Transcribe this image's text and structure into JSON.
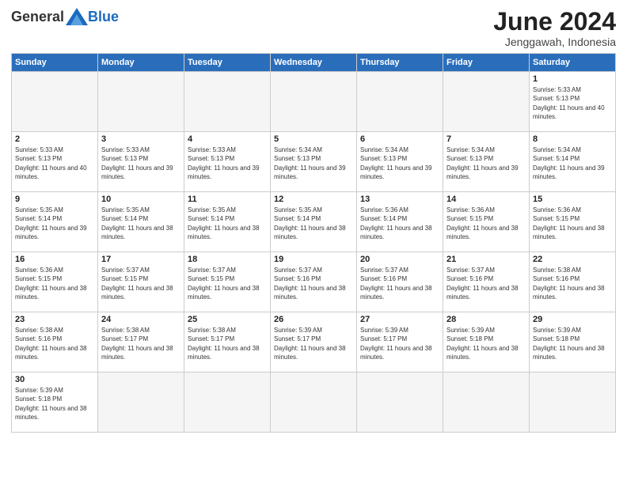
{
  "logo": {
    "general": "General",
    "blue": "Blue"
  },
  "title": {
    "month": "June 2024",
    "location": "Jenggawah, Indonesia"
  },
  "weekdays": [
    "Sunday",
    "Monday",
    "Tuesday",
    "Wednesday",
    "Thursday",
    "Friday",
    "Saturday"
  ],
  "weeks": [
    [
      {
        "day": "",
        "empty": true
      },
      {
        "day": "",
        "empty": true
      },
      {
        "day": "",
        "empty": true
      },
      {
        "day": "",
        "empty": true
      },
      {
        "day": "",
        "empty": true
      },
      {
        "day": "",
        "empty": true
      },
      {
        "day": "1",
        "sunrise": "Sunrise: 5:33 AM",
        "sunset": "Sunset: 5:13 PM",
        "daylight": "Daylight: 11 hours and 40 minutes."
      }
    ],
    [
      {
        "day": "2",
        "sunrise": "Sunrise: 5:33 AM",
        "sunset": "Sunset: 5:13 PM",
        "daylight": "Daylight: 11 hours and 40 minutes."
      },
      {
        "day": "3",
        "sunrise": "Sunrise: 5:33 AM",
        "sunset": "Sunset: 5:13 PM",
        "daylight": "Daylight: 11 hours and 39 minutes."
      },
      {
        "day": "4",
        "sunrise": "Sunrise: 5:33 AM",
        "sunset": "Sunset: 5:13 PM",
        "daylight": "Daylight: 11 hours and 39 minutes."
      },
      {
        "day": "5",
        "sunrise": "Sunrise: 5:34 AM",
        "sunset": "Sunset: 5:13 PM",
        "daylight": "Daylight: 11 hours and 39 minutes."
      },
      {
        "day": "6",
        "sunrise": "Sunrise: 5:34 AM",
        "sunset": "Sunset: 5:13 PM",
        "daylight": "Daylight: 11 hours and 39 minutes."
      },
      {
        "day": "7",
        "sunrise": "Sunrise: 5:34 AM",
        "sunset": "Sunset: 5:13 PM",
        "daylight": "Daylight: 11 hours and 39 minutes."
      },
      {
        "day": "8",
        "sunrise": "Sunrise: 5:34 AM",
        "sunset": "Sunset: 5:14 PM",
        "daylight": "Daylight: 11 hours and 39 minutes."
      }
    ],
    [
      {
        "day": "9",
        "sunrise": "Sunrise: 5:35 AM",
        "sunset": "Sunset: 5:14 PM",
        "daylight": "Daylight: 11 hours and 39 minutes."
      },
      {
        "day": "10",
        "sunrise": "Sunrise: 5:35 AM",
        "sunset": "Sunset: 5:14 PM",
        "daylight": "Daylight: 11 hours and 38 minutes."
      },
      {
        "day": "11",
        "sunrise": "Sunrise: 5:35 AM",
        "sunset": "Sunset: 5:14 PM",
        "daylight": "Daylight: 11 hours and 38 minutes."
      },
      {
        "day": "12",
        "sunrise": "Sunrise: 5:35 AM",
        "sunset": "Sunset: 5:14 PM",
        "daylight": "Daylight: 11 hours and 38 minutes."
      },
      {
        "day": "13",
        "sunrise": "Sunrise: 5:36 AM",
        "sunset": "Sunset: 5:14 PM",
        "daylight": "Daylight: 11 hours and 38 minutes."
      },
      {
        "day": "14",
        "sunrise": "Sunrise: 5:36 AM",
        "sunset": "Sunset: 5:15 PM",
        "daylight": "Daylight: 11 hours and 38 minutes."
      },
      {
        "day": "15",
        "sunrise": "Sunrise: 5:36 AM",
        "sunset": "Sunset: 5:15 PM",
        "daylight": "Daylight: 11 hours and 38 minutes."
      }
    ],
    [
      {
        "day": "16",
        "sunrise": "Sunrise: 5:36 AM",
        "sunset": "Sunset: 5:15 PM",
        "daylight": "Daylight: 11 hours and 38 minutes."
      },
      {
        "day": "17",
        "sunrise": "Sunrise: 5:37 AM",
        "sunset": "Sunset: 5:15 PM",
        "daylight": "Daylight: 11 hours and 38 minutes."
      },
      {
        "day": "18",
        "sunrise": "Sunrise: 5:37 AM",
        "sunset": "Sunset: 5:15 PM",
        "daylight": "Daylight: 11 hours and 38 minutes."
      },
      {
        "day": "19",
        "sunrise": "Sunrise: 5:37 AM",
        "sunset": "Sunset: 5:16 PM",
        "daylight": "Daylight: 11 hours and 38 minutes."
      },
      {
        "day": "20",
        "sunrise": "Sunrise: 5:37 AM",
        "sunset": "Sunset: 5:16 PM",
        "daylight": "Daylight: 11 hours and 38 minutes."
      },
      {
        "day": "21",
        "sunrise": "Sunrise: 5:37 AM",
        "sunset": "Sunset: 5:16 PM",
        "daylight": "Daylight: 11 hours and 38 minutes."
      },
      {
        "day": "22",
        "sunrise": "Sunrise: 5:38 AM",
        "sunset": "Sunset: 5:16 PM",
        "daylight": "Daylight: 11 hours and 38 minutes."
      }
    ],
    [
      {
        "day": "23",
        "sunrise": "Sunrise: 5:38 AM",
        "sunset": "Sunset: 5:16 PM",
        "daylight": "Daylight: 11 hours and 38 minutes."
      },
      {
        "day": "24",
        "sunrise": "Sunrise: 5:38 AM",
        "sunset": "Sunset: 5:17 PM",
        "daylight": "Daylight: 11 hours and 38 minutes."
      },
      {
        "day": "25",
        "sunrise": "Sunrise: 5:38 AM",
        "sunset": "Sunset: 5:17 PM",
        "daylight": "Daylight: 11 hours and 38 minutes."
      },
      {
        "day": "26",
        "sunrise": "Sunrise: 5:39 AM",
        "sunset": "Sunset: 5:17 PM",
        "daylight": "Daylight: 11 hours and 38 minutes."
      },
      {
        "day": "27",
        "sunrise": "Sunrise: 5:39 AM",
        "sunset": "Sunset: 5:17 PM",
        "daylight": "Daylight: 11 hours and 38 minutes."
      },
      {
        "day": "28",
        "sunrise": "Sunrise: 5:39 AM",
        "sunset": "Sunset: 5:18 PM",
        "daylight": "Daylight: 11 hours and 38 minutes."
      },
      {
        "day": "29",
        "sunrise": "Sunrise: 5:39 AM",
        "sunset": "Sunset: 5:18 PM",
        "daylight": "Daylight: 11 hours and 38 minutes."
      }
    ],
    [
      {
        "day": "30",
        "sunrise": "Sunrise: 5:39 AM",
        "sunset": "Sunset: 5:18 PM",
        "daylight": "Daylight: 11 hours and 38 minutes."
      },
      {
        "day": "",
        "empty": true
      },
      {
        "day": "",
        "empty": true
      },
      {
        "day": "",
        "empty": true
      },
      {
        "day": "",
        "empty": true
      },
      {
        "day": "",
        "empty": true
      },
      {
        "day": "",
        "empty": true
      }
    ]
  ]
}
